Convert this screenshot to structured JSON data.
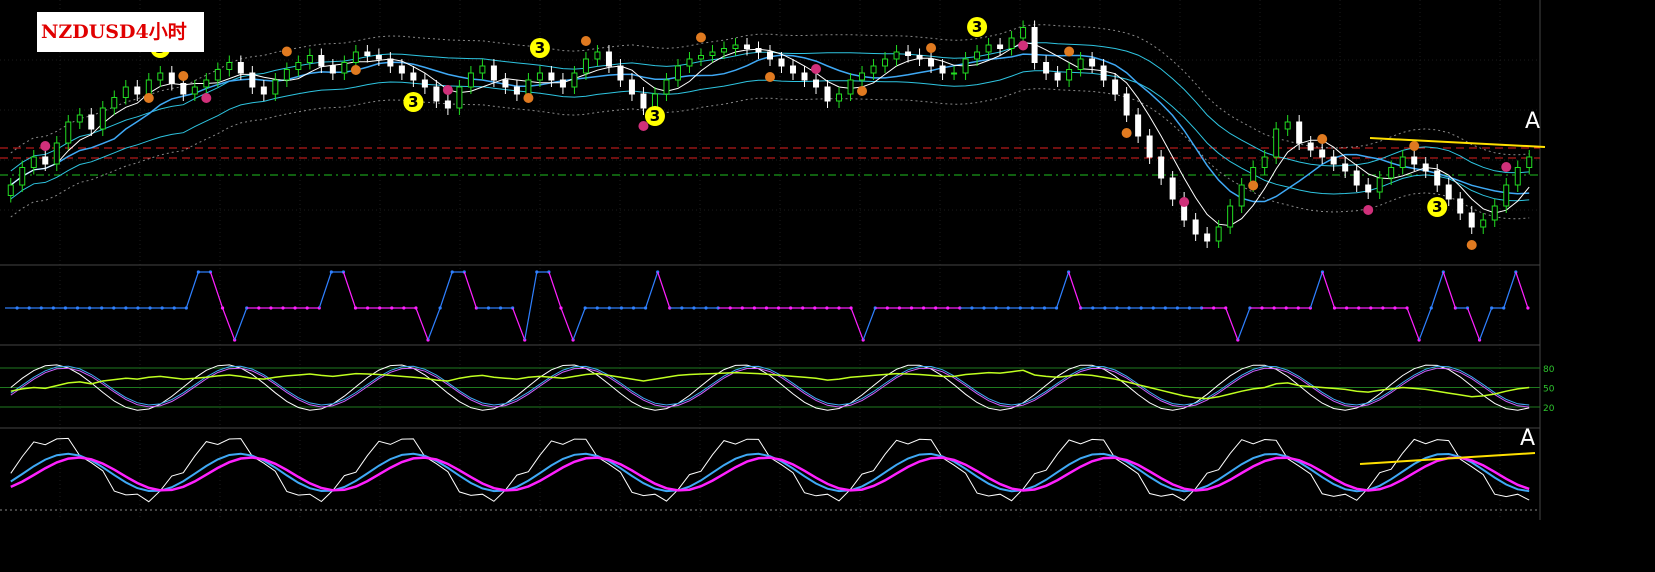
{
  "title": "NZDUSD4小时",
  "annotations": {
    "label_a": "A",
    "wave_number": "3"
  },
  "colors": {
    "background": "#000000",
    "bull_candle": "#22dd22",
    "bear_candle": "#ffffff",
    "bands": "#3fa9f5",
    "channel": "#2ec4e0",
    "ma_white": "#ffffff",
    "resistance_red": "#e02020",
    "support_green": "#20c020",
    "trendline": "#ffe000",
    "zigzag_up": "#2f80ff",
    "zigzag_down": "#ff20ff",
    "wave3": "#ffff00",
    "marker_orange": "#e07a20",
    "marker_pink": "#d0307a"
  },
  "chart_data": [
    {
      "type": "candlestick",
      "panel": "price",
      "close": [
        0.5,
        0.55,
        0.58,
        0.56,
        0.62,
        0.68,
        0.7,
        0.66,
        0.72,
        0.75,
        0.78,
        0.76,
        0.8,
        0.82,
        0.79,
        0.76,
        0.78,
        0.8,
        0.83,
        0.85,
        0.82,
        0.78,
        0.76,
        0.8,
        0.83,
        0.85,
        0.87,
        0.84,
        0.82,
        0.85,
        0.88,
        0.87,
        0.86,
        0.84,
        0.82,
        0.8,
        0.78,
        0.74,
        0.72,
        0.78,
        0.82,
        0.84,
        0.8,
        0.78,
        0.76,
        0.8,
        0.82,
        0.8,
        0.78,
        0.82,
        0.86,
        0.88,
        0.84,
        0.8,
        0.76,
        0.72,
        0.76,
        0.8,
        0.84,
        0.86,
        0.87,
        0.88,
        0.89,
        0.9,
        0.89,
        0.88,
        0.86,
        0.84,
        0.82,
        0.8,
        0.78,
        0.74,
        0.76,
        0.8,
        0.82,
        0.84,
        0.86,
        0.88,
        0.87,
        0.86,
        0.84,
        0.82,
        0.82,
        0.86,
        0.88,
        0.9,
        0.89,
        0.92,
        0.95,
        0.85,
        0.82,
        0.8,
        0.83,
        0.86,
        0.84,
        0.8,
        0.76,
        0.7,
        0.64,
        0.58,
        0.52,
        0.46,
        0.4,
        0.36,
        0.34,
        0.38,
        0.44,
        0.5,
        0.55,
        0.58,
        0.66,
        0.68,
        0.62,
        0.6,
        0.58,
        0.56,
        0.54,
        0.5,
        0.48,
        0.52,
        0.55,
        0.58,
        0.56,
        0.54,
        0.5,
        0.46,
        0.42,
        0.38,
        0.4,
        0.44,
        0.5,
        0.55,
        0.58
      ],
      "wave3_markers": [
        {
          "i": 13
        },
        {
          "i": 35
        },
        {
          "i": 46
        },
        {
          "i": 56
        },
        {
          "i": 84
        },
        {
          "i": 124
        }
      ],
      "ylim": [
        0.3,
        1.0
      ]
    },
    {
      "type": "line",
      "panel": "zigzag",
      "note_levels": "0=low,1=mid,2=high",
      "values": [
        1,
        1,
        1,
        1,
        1,
        1,
        1,
        1,
        1,
        1,
        1,
        1,
        1,
        1,
        1,
        1,
        2,
        2,
        1,
        0,
        1,
        1,
        1,
        1,
        1,
        1,
        1,
        2,
        2,
        1,
        1,
        1,
        1,
        1,
        1,
        0,
        1,
        2,
        2,
        1,
        1,
        1,
        1,
        0,
        2,
        2,
        1,
        0,
        1,
        1,
        1,
        1,
        1,
        1,
        2,
        1,
        1,
        1,
        1,
        1,
        1,
        1,
        1,
        1,
        1,
        1,
        1,
        1,
        1,
        1,
        1,
        0,
        1,
        1,
        1,
        1,
        1,
        1,
        1,
        1,
        1,
        1,
        1,
        1,
        1,
        1,
        1,
        1,
        2,
        1,
        1,
        1,
        1,
        1,
        1,
        1,
        1,
        1,
        1,
        1,
        1,
        1,
        0,
        1,
        1,
        1,
        1,
        1,
        1,
        2,
        1,
        1,
        1,
        1,
        1,
        1,
        1,
        0,
        1,
        2,
        1,
        1,
        0,
        1,
        1,
        2,
        1
      ]
    },
    {
      "type": "line",
      "panel": "oscillator",
      "levels": [
        80,
        50,
        20
      ],
      "ylim": [
        0,
        100
      ]
    },
    {
      "type": "line",
      "panel": "stochastic",
      "ylim": [
        0,
        100
      ]
    }
  ]
}
